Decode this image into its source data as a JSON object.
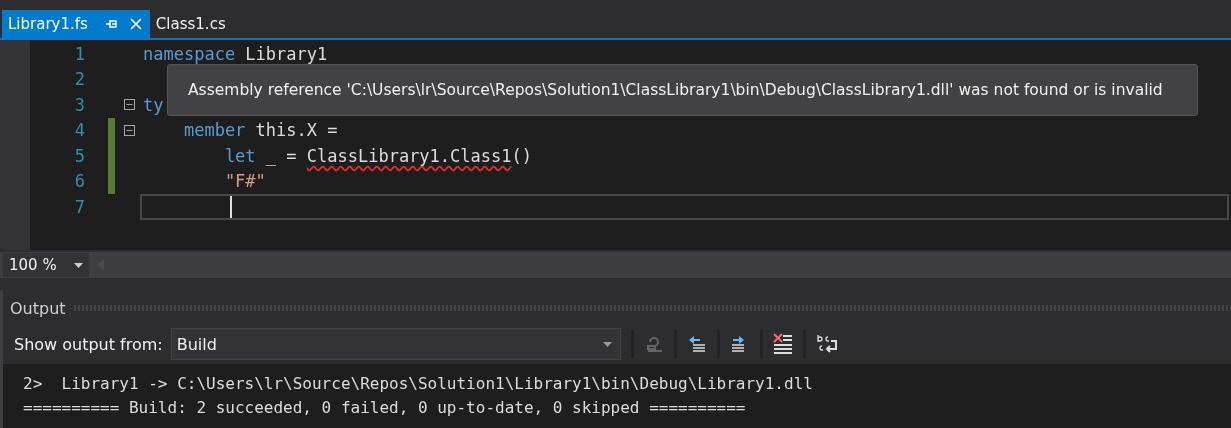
{
  "tabs": [
    {
      "label": "Library1.fs",
      "selected": true
    },
    {
      "label": "Class1.cs",
      "selected": false
    }
  ],
  "editor": {
    "lines": [
      {
        "number": "1",
        "changed": false,
        "fold": false,
        "current": false,
        "tokens": [
          {
            "kind": "keyword",
            "text": "namespace",
            "error": false
          },
          {
            "kind": "plain",
            "text": " Library1",
            "error": false
          }
        ]
      },
      {
        "number": "2",
        "changed": false,
        "fold": false,
        "current": false
      },
      {
        "number": "3",
        "changed": false,
        "fold": true,
        "current": false,
        "tokens": [
          {
            "kind": "keyword",
            "text": "ty",
            "error": false
          }
        ]
      },
      {
        "number": "4",
        "changed": true,
        "fold": true,
        "current": false,
        "tokens": [
          {
            "kind": "keyword",
            "text": "    member",
            "error": false
          },
          {
            "kind": "plain",
            "text": " this.X =",
            "error": false
          }
        ]
      },
      {
        "number": "5",
        "changed": true,
        "fold": false,
        "current": false,
        "tokens": [
          {
            "kind": "keyword",
            "text": "        let",
            "error": false
          },
          {
            "kind": "plain",
            "text": " _ = ",
            "error": false
          },
          {
            "kind": "plain",
            "text": "ClassLibrary1.Class1",
            "error": true
          },
          {
            "kind": "plain",
            "text": "()",
            "error": false
          }
        ]
      },
      {
        "number": "6",
        "changed": true,
        "fold": false,
        "current": false,
        "tokens": [
          {
            "kind": "string",
            "text": "        \"F#\"",
            "error": false
          }
        ]
      },
      {
        "number": "7",
        "changed": false,
        "fold": false,
        "current": true
      }
    ],
    "tooltip": "Assembly reference 'C:\\Users\\lr\\Source\\Repos\\Solution1\\ClassLibrary1\\bin\\Debug\\ClassLibrary1.dll' was not found or is invalid",
    "zoom": "100 %"
  },
  "output": {
    "title": "Output",
    "show_from_label": "Show output from:",
    "source": "Build",
    "toolbar": [
      {
        "kind": "go-to-source",
        "disabled": true
      },
      {
        "kind": "previous-message",
        "disabled": false
      },
      {
        "kind": "next-message",
        "disabled": false
      },
      {
        "kind": "clear-all",
        "disabled": false
      },
      {
        "kind": "word-wrap",
        "disabled": false
      }
    ],
    "lines": [
      "2>  Library1 -> C:\\Users\\lr\\Source\\Repos\\Solution1\\Library1\\bin\\Debug\\Library1.dll",
      "========== Build: 2 succeeded, 0 failed, 0 up-to-date, 0 skipped =========="
    ]
  }
}
